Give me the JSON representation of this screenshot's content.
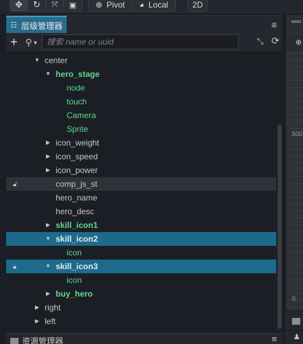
{
  "toolbar": {
    "move_icon": "move-icon",
    "rotate_icon": "rotate-icon",
    "scale_icon": "scale-icon",
    "rect_icon": "rect-icon",
    "pivot_label": "Pivot",
    "local_label": "Local",
    "mode_2d_label": "2D"
  },
  "hierarchy": {
    "tab_label": "层级管理器",
    "search_placeholder": "搜索 name or uuid",
    "search_value": "",
    "nodes": [
      {
        "name": "center",
        "expanded": true
      },
      {
        "name": "hero_stage",
        "expanded": true
      },
      {
        "name": "node"
      },
      {
        "name": "touch"
      },
      {
        "name": "Camera"
      },
      {
        "name": "Sprite"
      },
      {
        "name": "icon_weight",
        "expanded": false
      },
      {
        "name": "icon_speed",
        "expanded": false
      },
      {
        "name": "icon_power",
        "expanded": false
      },
      {
        "name": "comp_js_st",
        "locked": true,
        "lock_open": true
      },
      {
        "name": "hero_name"
      },
      {
        "name": "hero_desc"
      },
      {
        "name": "skill_icon1",
        "expanded": false
      },
      {
        "name": "skill_icon2",
        "expanded": true,
        "selected": true
      },
      {
        "name": "icon"
      },
      {
        "name": "skill_icon3",
        "expanded": true,
        "selected": true,
        "locked": true
      },
      {
        "name": "icon"
      },
      {
        "name": "buy_hero",
        "expanded": false
      },
      {
        "name": "right",
        "expanded": false
      },
      {
        "name": "left",
        "expanded": false
      }
    ]
  },
  "assets": {
    "tab_label": "资源管理器"
  },
  "scene": {
    "ruler_label_top": "500",
    "ruler_label_bottom": "0"
  },
  "colors": {
    "selected_row": "#1c6b8d",
    "prefab_text": "#63d98b",
    "panel_bg": "#1b1e24"
  }
}
